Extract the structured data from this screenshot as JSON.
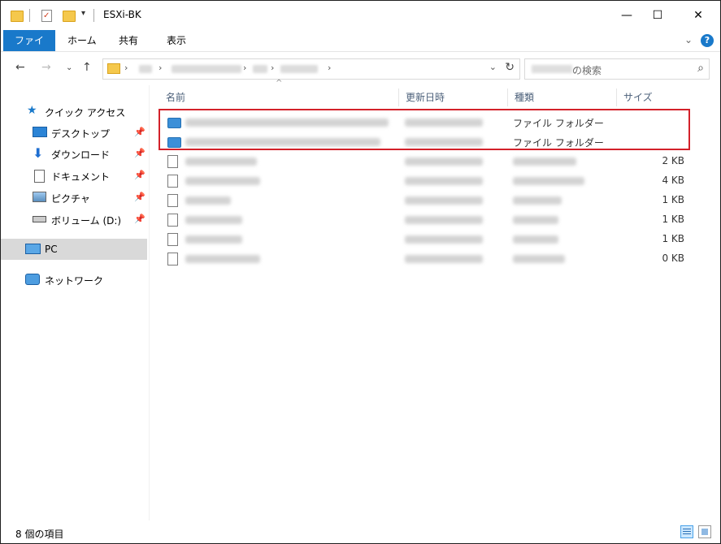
{
  "window": {
    "title": "ESXi-BK",
    "minimize": "—",
    "maximize": "☐",
    "close": "✕"
  },
  "ribbon": {
    "tabs": [
      "ファイル",
      "ホーム",
      "共有",
      "表示"
    ],
    "help": "?"
  },
  "address": {
    "refresh": "↻",
    "dropdown": "⌄"
  },
  "search": {
    "placeholder_suffix": "の検索"
  },
  "nav": {
    "quick_access": "クイック アクセス",
    "items": [
      "デスクトップ",
      "ダウンロード",
      "ドキュメント",
      "ピクチャ",
      "ボリューム (D:)"
    ],
    "pc": "PC",
    "network": "ネットワーク"
  },
  "columns": {
    "name": "名前",
    "modified": "更新日時",
    "type": "種類",
    "size": "サイズ"
  },
  "files": [
    {
      "type": "ファイル フォルダー",
      "size": ""
    },
    {
      "type": "ファイル フォルダー",
      "size": ""
    },
    {
      "type": "",
      "size": "2 KB"
    },
    {
      "type": "",
      "size": "4 KB"
    },
    {
      "type": "",
      "size": "1 KB"
    },
    {
      "type": "",
      "size": "1 KB"
    },
    {
      "type": "",
      "size": "1 KB"
    },
    {
      "type": "",
      "size": "0 KB"
    }
  ],
  "status": {
    "item_count": "8 個の項目"
  },
  "colors": {
    "accent": "#1979ca",
    "highlight": "#d3212a",
    "selected": "#d9d9d9"
  }
}
